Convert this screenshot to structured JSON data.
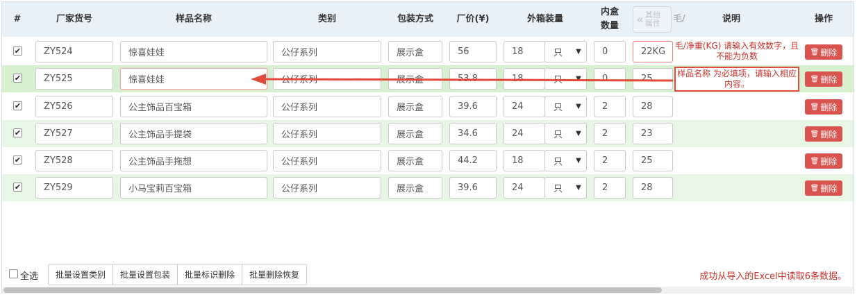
{
  "header": {
    "index": "#",
    "item_no": "厂家货号",
    "name": "样品名称",
    "category": "类别",
    "packaging": "包装方式",
    "price": "厂价(¥)",
    "carton_qty": "外箱装量",
    "inner_qty": "内盒数量",
    "more_props": "其他属性",
    "more_cut": "毛/",
    "note": "说明",
    "action": "操作"
  },
  "rows": [
    {
      "checked": "✔",
      "item_no": "ZY524",
      "name": "惊喜娃娃",
      "category": "公仔系列",
      "packaging": "展示盒",
      "price": "56",
      "carton": "18",
      "unit": "只",
      "inner": "0",
      "weight": "22KG",
      "note": "毛/净重(KG) 请输入有效数字，且不能为负数"
    },
    {
      "checked": "✔",
      "item_no": "ZY525",
      "name": "惊喜娃娃",
      "category": "公仔系列",
      "packaging": "展示盒",
      "price": "53.8",
      "carton": "18",
      "unit": "只",
      "inner": "0",
      "weight": "25",
      "note": "样品名称 为必填项，请输入相应内容。"
    },
    {
      "checked": "✔",
      "item_no": "ZY526",
      "name": "公主饰品百宝箱",
      "category": "公仔系列",
      "packaging": "展示盒",
      "price": "39.6",
      "carton": "24",
      "unit": "只",
      "inner": "2",
      "weight": "28",
      "note": ""
    },
    {
      "checked": "✔",
      "item_no": "ZY527",
      "name": "公主饰品手提袋",
      "category": "公仔系列",
      "packaging": "展示盒",
      "price": "34.6",
      "carton": "24",
      "unit": "只",
      "inner": "2",
      "weight": "23",
      "note": ""
    },
    {
      "checked": "✔",
      "item_no": "ZY528",
      "name": "公主饰品手拖想",
      "category": "公仔系列",
      "packaging": "展示盒",
      "price": "44.2",
      "carton": "18",
      "unit": "只",
      "inner": "2",
      "weight": "25",
      "note": ""
    },
    {
      "checked": "✔",
      "item_no": "ZY529",
      "name": "小马宝莉百宝箱",
      "category": "公仔系列",
      "packaging": "展示盒",
      "price": "39.6",
      "carton": "24",
      "unit": "只",
      "inner": "2",
      "weight": "28",
      "note": ""
    }
  ],
  "delete_label": "删除",
  "footer": {
    "select_all": "全选",
    "buttons": [
      "批量设置类别",
      "批量设置包装",
      "批量标识删除",
      "批量删除恢复"
    ],
    "status": "成功从导入的Excel中读取6条数据。"
  },
  "colors": {
    "error": "#c9302c",
    "delete_button": "#d9534f",
    "arrow": "#e24a3b"
  }
}
